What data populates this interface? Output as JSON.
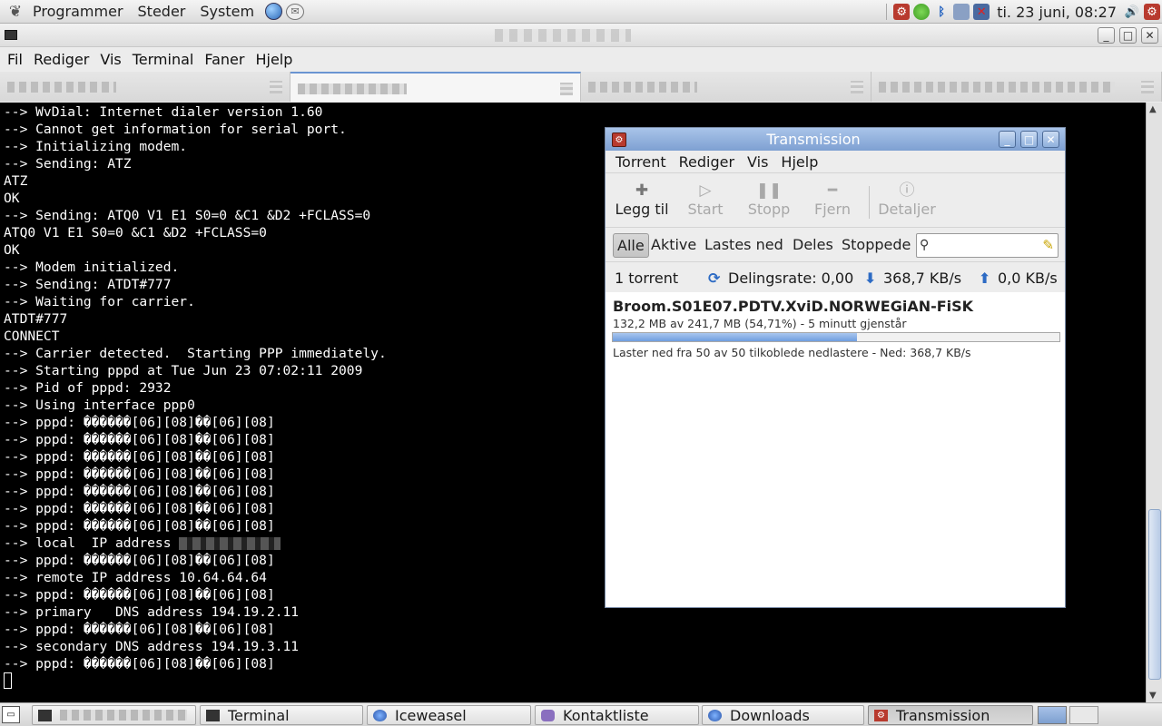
{
  "top_panel": {
    "menus": [
      "Programmer",
      "Steder",
      "System"
    ],
    "clock": "ti. 23 juni, 08:27"
  },
  "terminal_window": {
    "menus": [
      "Fil",
      "Rediger",
      "Vis",
      "Terminal",
      "Faner",
      "Hjelp"
    ],
    "lines": [
      "--> WvDial: Internet dialer version 1.60",
      "--> Cannot get information for serial port.",
      "--> Initializing modem.",
      "--> Sending: ATZ",
      "ATZ",
      "OK",
      "--> Sending: ATQ0 V1 E1 S0=0 &C1 &D2 +FCLASS=0",
      "ATQ0 V1 E1 S0=0 &C1 &D2 +FCLASS=0",
      "OK",
      "--> Modem initialized.",
      "--> Sending: ATDT#777",
      "--> Waiting for carrier.",
      "ATDT#777",
      "CONNECT",
      "--> Carrier detected.  Starting PPP immediately.",
      "--> Starting pppd at Tue Jun 23 07:02:11 2009",
      "--> Pid of pppd: 2932",
      "--> Using interface ppp0",
      "--> pppd: ������[06][08]��[06][08]",
      "--> pppd: ������[06][08]��[06][08]",
      "--> pppd: ������[06][08]��[06][08]",
      "--> pppd: ������[06][08]��[06][08]",
      "--> pppd: ������[06][08]��[06][08]",
      "--> pppd: ������[06][08]��[06][08]",
      "--> pppd: ������[06][08]��[06][08]",
      "--> local  IP address ",
      "--> pppd: ������[06][08]��[06][08]",
      "--> remote IP address 10.64.64.64",
      "--> pppd: ������[06][08]��[06][08]",
      "--> primary   DNS address 194.19.2.11",
      "--> pppd: ������[06][08]��[06][08]",
      "--> secondary DNS address 194.19.3.11",
      "--> pppd: ������[06][08]��[06][08]"
    ]
  },
  "transmission": {
    "title": "Transmission",
    "menus": [
      "Torrent",
      "Rediger",
      "Vis",
      "Hjelp"
    ],
    "toolbar": {
      "add": "Legg til",
      "start": "Start",
      "stop": "Stopp",
      "remove": "Fjern",
      "details": "Detaljer"
    },
    "filters": [
      "Alle",
      "Aktive",
      "Lastes ned",
      "Deles",
      "Stoppede"
    ],
    "status": {
      "count": "1 torrent",
      "ratio": "Delingsrate: 0,00",
      "down": "368,7 KB/s",
      "up": "0,0 KB/s"
    },
    "torrent": {
      "name": "Broom.S01E07.PDTV.XviD.NORWEGiAN-FiSK",
      "progress_text": "132,2 MB av 241,7 MB (54,71%) - 5 minutt gjenstår",
      "progress_fraction": 0.5471,
      "status_text": "Laster ned fra 50 av 50 tilkoblede nedlastere - Ned: 368,7 KB/s"
    }
  },
  "taskbar": {
    "tasks": [
      "Terminal",
      "Iceweasel",
      "Kontaktliste",
      "Downloads",
      "Transmission"
    ]
  }
}
